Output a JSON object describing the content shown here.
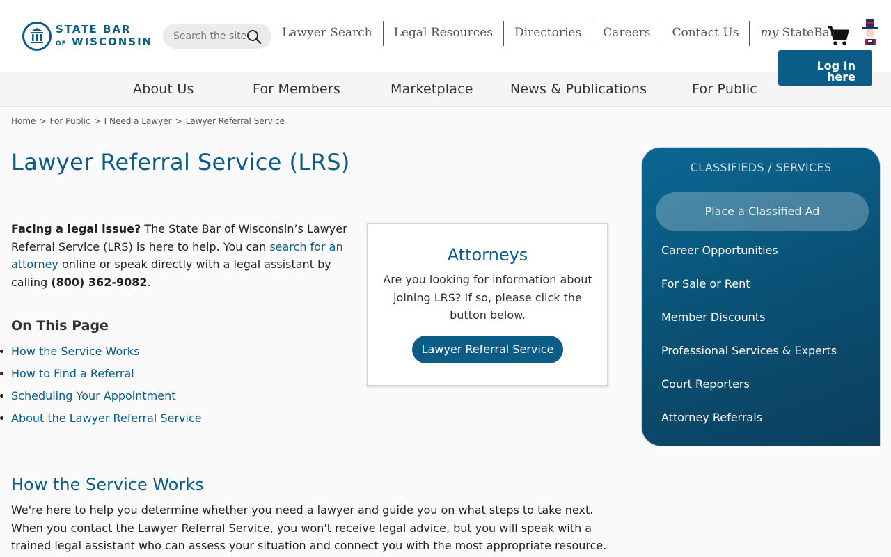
{
  "header": {
    "logo": {
      "line1": "STATE BAR",
      "line2_prefix": "OF",
      "line2": "WISCONSIN"
    },
    "search": {
      "placeholder": "Search the site"
    },
    "top_nav": [
      {
        "label": "Lawyer Search"
      },
      {
        "label": "Legal Resources"
      },
      {
        "label": "Directories"
      },
      {
        "label": "Careers"
      },
      {
        "label": "Contact Us"
      }
    ],
    "my_statebar": {
      "prefix": "my",
      "label": "StateBar"
    },
    "login": {
      "line1": "Log In",
      "line2": "here"
    }
  },
  "main_nav": [
    {
      "label": "About Us"
    },
    {
      "label": "For Members"
    },
    {
      "label": "Marketplace"
    },
    {
      "label": "News & Publications"
    },
    {
      "label": "For Public"
    }
  ],
  "breadcrumb": [
    "Home",
    "For Public",
    "I Need a Lawyer",
    "Lawyer Referral Service"
  ],
  "page": {
    "title": "Lawyer Referral Service (LRS)",
    "intro": {
      "bold_lead": "Facing a legal issue?",
      "text1": " The State Bar of Wisconsin’s Lawyer Referral Service (LRS) is here to help. You can ",
      "link": "search for an attorney",
      "text2": " online or speak directly with a legal assistant by calling ",
      "phone": "(800) 362-9082",
      "text3": "."
    },
    "on_this_page": {
      "heading": "On This Page",
      "items": [
        {
          "label": "How the Service Works"
        },
        {
          "label": "How to Find a Referral"
        },
        {
          "label": "Scheduling Your Appointment"
        },
        {
          "label": "About the Lawyer Referral Service"
        }
      ]
    },
    "attorneys_card": {
      "title": "Attorneys",
      "text": "Are you looking for information about joining LRS? If so, please click the button below.",
      "button": "Lawyer Referral Service"
    },
    "section": {
      "title": "How the Service Works",
      "text": "We're here to help you determine whether you need a lawyer and guide you on what steps to take next. When you contact the Lawyer Referral Service, you won't receive legal advice, but you will speak with a trained legal assistant who can assess your situation and connect you with the most appropriate resource."
    }
  },
  "sidebar": {
    "title": "CLASSIFIEDS / SERVICES",
    "button": "Place a Classified Ad",
    "links": [
      {
        "label": "Career Opportunities"
      },
      {
        "label": "For Sale or Rent"
      },
      {
        "label": "Member Discounts"
      },
      {
        "label": "Professional Services & Experts"
      },
      {
        "label": "Court Reporters"
      },
      {
        "label": "Attorney Referrals"
      }
    ]
  },
  "colors": {
    "brand": "#0b5c86",
    "sidebar_bg": "#0a4f72"
  },
  "icons": [
    "search-icon",
    "cart-icon",
    "mascot-icon",
    "seal-icon"
  ]
}
